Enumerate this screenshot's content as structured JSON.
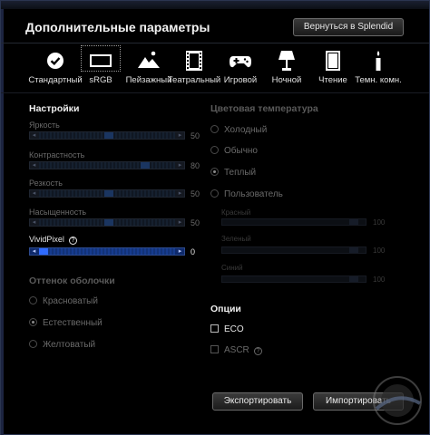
{
  "header": {
    "title": "Дополнительные параметры",
    "back_label": "Вернуться в Splendid"
  },
  "modes": [
    {
      "label": "Стандартный",
      "icon": "check-circle-icon"
    },
    {
      "label": "sRGB",
      "icon": "monitor-icon",
      "selected": true
    },
    {
      "label": "Пейзажный",
      "icon": "mountain-icon"
    },
    {
      "label": "Театральный",
      "icon": "film-icon"
    },
    {
      "label": "Игровой",
      "icon": "gamepad-icon"
    },
    {
      "label": "Ночной",
      "icon": "lamp-icon"
    },
    {
      "label": "Чтение",
      "icon": "book-icon"
    },
    {
      "label": "Темн. комн.",
      "icon": "candle-icon"
    }
  ],
  "settings": {
    "title": "Настройки",
    "sliders": [
      {
        "label": "Яркость",
        "value": "50",
        "level": 0.5
      },
      {
        "label": "Контрастность",
        "value": "80",
        "level": 0.8
      },
      {
        "label": "Резкость",
        "value": "50",
        "level": 0.5
      },
      {
        "label": "Насыщенность",
        "value": "50",
        "level": 0.5
      },
      {
        "label": "VividPixel",
        "value": "0",
        "level": 0.0
      }
    ]
  },
  "shade": {
    "title": "Оттенок оболочки",
    "options": [
      "Красноватый",
      "Естественный",
      "Желтоватый"
    ],
    "selected": "Естественный"
  },
  "color_temp": {
    "title": "Цветовая температура",
    "options": [
      "Холодный",
      "Обычно",
      "Теплый",
      "Пользователь"
    ],
    "selected": "Теплый",
    "user_sliders": [
      {
        "label": "Красный",
        "value": "100"
      },
      {
        "label": "Зеленый",
        "value": "100"
      },
      {
        "label": "Синий",
        "value": "100"
      }
    ]
  },
  "options": {
    "title": "Опции",
    "eco_label": "ECO",
    "ascr_label": "ASCR"
  },
  "buttons": {
    "export_label": "Экспортировать",
    "import_label": "Импортировать"
  },
  "colors": {
    "accent": "#2f6bff",
    "slider_active": "#0f2a6b",
    "bg": "#000000"
  }
}
